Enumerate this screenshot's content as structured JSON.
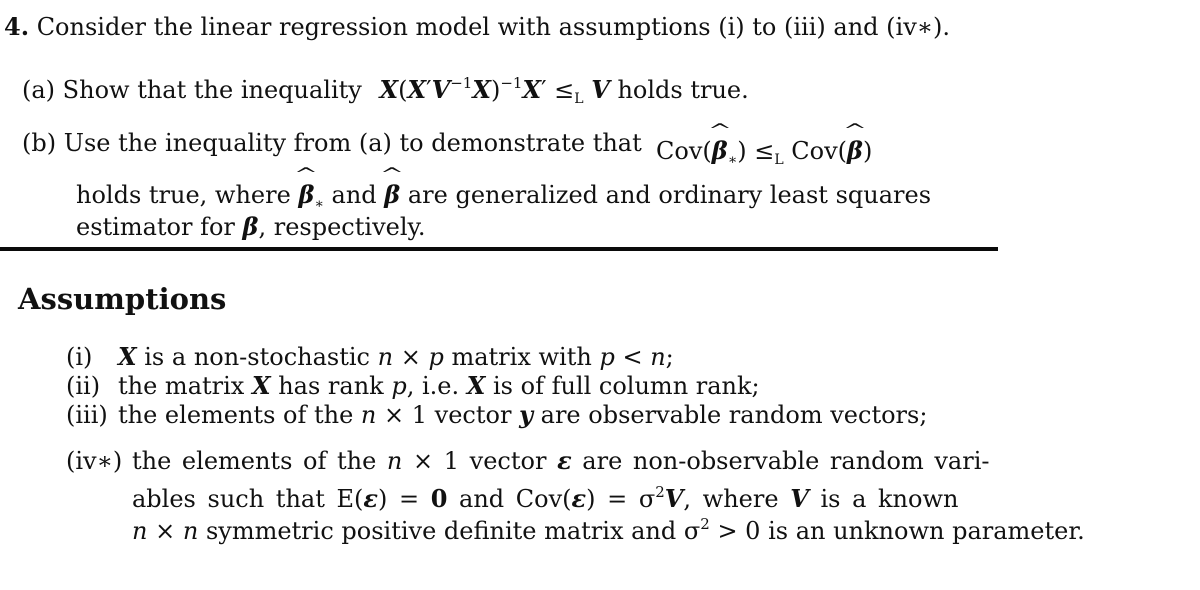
{
  "question": {
    "number": "4.",
    "intro": "Consider the linear regression model with assumptions (i) to (iii) and (iv∗).",
    "part_a": {
      "label": "(a)",
      "text_before": "Show that the inequality",
      "formula": "X(X′V⁻¹X)⁻¹X′ ≤L V",
      "text_after": "holds true."
    },
    "part_b": {
      "label": "(b)",
      "text_before": "Use the inequality from (a) to demonstrate that",
      "formula": "Cov(β̂∗) ≤L Cov(β̂)",
      "line2": "holds true, where β̂∗ and β̂ are generalized and ordinary least squares",
      "line3": "estimator for β, respectively."
    }
  },
  "assumptions": {
    "heading": "Assumptions",
    "items": [
      {
        "label": "(i)",
        "text": "X is a non-stochastic n × p matrix with p < n;"
      },
      {
        "label": "(ii)",
        "text": "the matrix X has rank p, i.e. X is of full column rank;"
      },
      {
        "label": "(iii)",
        "text": "the elements of the n × 1 vector y are observable random vectors;"
      },
      {
        "label": "(iv∗)",
        "lines": [
          "the elements of the n × 1 vector ε are non-observable random vari-",
          "ables such that E(ε) = 0 and Cov(ε) = σ²V, where V is a known",
          "n × n symmetric positive definite matrix and σ² > 0 is an unknown parameter."
        ]
      }
    ]
  },
  "tokens": {
    "q_num": "4.",
    "q_intro": " Consider the linear regression model with assumptions (i) to (iii) and (iv∗).",
    "a_label": "(a)",
    "a_text": " Show that the inequality",
    "X": "X",
    "V": "V",
    "prime": "′",
    "lp": "(",
    "rp": ")",
    "minus_one": "−1",
    "leq": "≤",
    "L": "L",
    "a_after": "holds true.",
    "b_label": "(b)",
    "b_text": " Use the inequality from (a) to demonstrate that",
    "cov": "Cov",
    "beta": "β",
    "star": "∗",
    "caret": "^",
    "b2_1": "holds true, where ",
    "b2_2": " and ",
    "b2_3": " are generalized and ordinary least squares",
    "b3_1": "estimator for ",
    "b3_2": ", respectively.",
    "heading": "Assumptions",
    "i_label": "(i)",
    "i_1": " is a non-stochastic ",
    "n": "n",
    "p": "p",
    "times": " × ",
    "i_2": " matrix with ",
    "lt": " < ",
    "semi": ";",
    "ii_label": "(ii)",
    "ii_1": "the matrix ",
    "ii_2": " has rank ",
    "ii_3": ", i.e. ",
    "ii_4": " is of full column rank;",
    "iii_label": "(iii)",
    "iii_1": "the elements of the ",
    "iii_2": " × 1 vector ",
    "y": "y",
    "iii_3": " are observable random vectors;",
    "iv_label": "(iv∗)",
    "iv1_1": "the elements of the ",
    "iv1_2": " × 1 vector ",
    "eps": "ε",
    "iv1_3": " are non-observable random vari-",
    "iv2_1": "ables such that E(",
    "iv2_2": ") = ",
    "zero": "0",
    "iv2_3": " and Cov(",
    "iv2_4": ") = σ",
    "two": "2",
    "iv2_5": ", where ",
    "iv2_6": " is a known",
    "iv3_1": " symmetric positive definite matrix and σ",
    "iv3_2": " > 0 is an unknown parameter."
  }
}
